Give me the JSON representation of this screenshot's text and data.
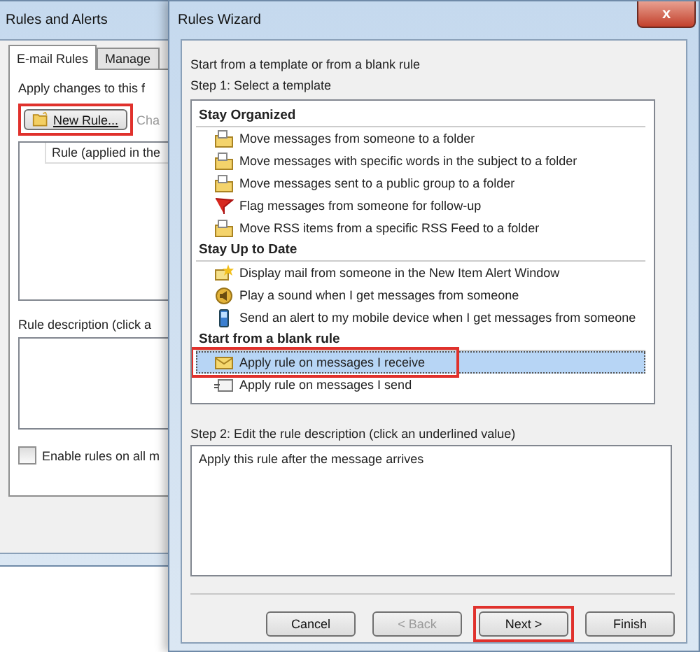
{
  "back_window": {
    "title": "Rules and Alerts",
    "tabs": [
      {
        "label": "E-mail Rules",
        "selected": true
      },
      {
        "label": "Manage",
        "selected": false
      }
    ],
    "intro": "Apply changes to this f",
    "buttons": [
      {
        "label": "New Rule...",
        "kind": "new-rule",
        "disabled": false,
        "highlighted": true
      },
      {
        "label": "Cha",
        "kind": "change",
        "disabled": true,
        "highlighted": false
      }
    ],
    "list_header": "Rule (applied in the",
    "description_label": "Rule description (click a",
    "checkbox": {
      "label": "Enable rules on all m",
      "checked": false
    }
  },
  "wizard": {
    "title": "Rules Wizard",
    "close": "x",
    "intro": "Start from a template or from a blank rule",
    "step1": "Step 1: Select a template",
    "groups": [
      {
        "heading": "Stay Organized",
        "items": [
          {
            "label": "Move messages from someone to a folder",
            "kind": "move",
            "selected": false
          },
          {
            "label": "Move messages with specific words in the subject to a folder",
            "kind": "move",
            "selected": false
          },
          {
            "label": "Move messages sent to a public group to a folder",
            "kind": "move",
            "selected": false
          },
          {
            "label": "Flag messages from someone for follow-up",
            "kind": "flag",
            "selected": false
          },
          {
            "label": "Move RSS items from a specific RSS Feed to a folder",
            "kind": "move",
            "selected": false
          }
        ]
      },
      {
        "heading": "Stay Up to Date",
        "items": [
          {
            "label": "Display mail from someone in the New Item Alert Window",
            "kind": "alert",
            "selected": false
          },
          {
            "label": "Play a sound when I get messages from someone",
            "kind": "sound",
            "selected": false
          },
          {
            "label": "Send an alert to my mobile device when I get messages from someone",
            "kind": "mobile",
            "selected": false
          }
        ]
      },
      {
        "heading": "Start from a blank rule",
        "items": [
          {
            "label": "Apply rule on messages I receive",
            "kind": "receive",
            "selected": true
          },
          {
            "label": "Apply rule on messages I send",
            "kind": "send",
            "selected": false
          }
        ]
      }
    ],
    "step2": "Step 2: Edit the rule description (click an underlined value)",
    "description": "Apply this rule after the message arrives",
    "buttons": [
      {
        "label": "Cancel",
        "disabled": false,
        "highlighted": false
      },
      {
        "label": "< Back",
        "disabled": true,
        "highlighted": false
      },
      {
        "label": "Next >",
        "disabled": false,
        "highlighted": true
      },
      {
        "label": "Finish",
        "disabled": false,
        "highlighted": false
      }
    ]
  }
}
